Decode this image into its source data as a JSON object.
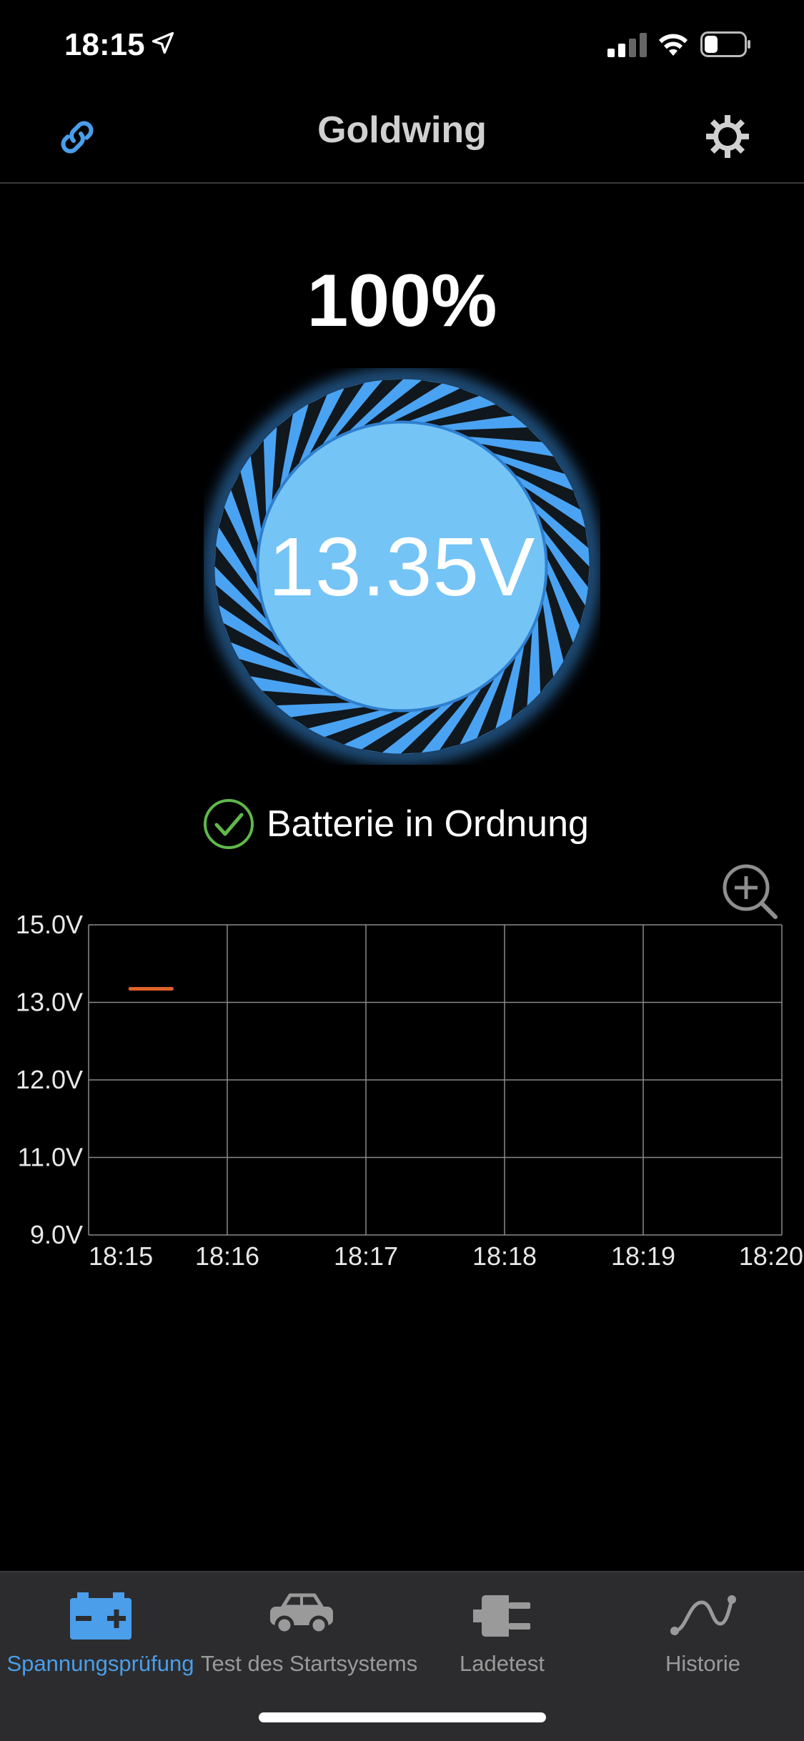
{
  "status_bar": {
    "time": "18:15"
  },
  "header": {
    "title": "Goldwing",
    "link_icon": "link-icon",
    "settings_icon": "gear-icon"
  },
  "gauge": {
    "percent": "100%",
    "voltage": "13.35V",
    "level": 1.0
  },
  "battery_status": {
    "text": "Batterie in Ordnung",
    "icon": "check-circle-icon"
  },
  "chart_data": {
    "type": "line",
    "y_tick_labels": [
      "15.0V",
      "13.0V",
      "12.0V",
      "11.0V",
      "9.0V"
    ],
    "x_tick_labels": [
      "18:15",
      "18:16",
      "18:17",
      "18:18",
      "18:19",
      "18:20"
    ],
    "series": [
      {
        "values": [
          13.35,
          13.35
        ],
        "x": [
          "18:15:18",
          "18:15:36"
        ],
        "color": "#e0622a"
      }
    ],
    "grid": true,
    "zoom_icon": "zoom-in-icon"
  },
  "tabs": [
    {
      "label": "Spannungsprüfung",
      "icon": "battery-icon",
      "active": true
    },
    {
      "label": "Test des Startsystems",
      "icon": "car-icon",
      "active": false
    },
    {
      "label": "Ladetest",
      "icon": "plug-icon",
      "active": false
    },
    {
      "label": "Historie",
      "icon": "curve-icon",
      "active": false
    }
  ],
  "colors": {
    "accent": "#4a9eea",
    "gauge_fill": "#74c4f6",
    "line": "#e0622a",
    "check": "#5fb84a"
  }
}
